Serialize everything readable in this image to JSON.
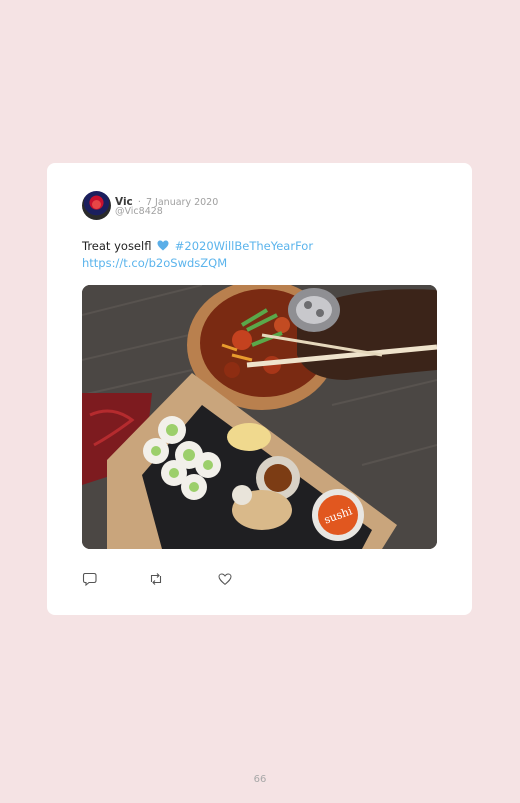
{
  "tweet": {
    "author_name": "Vic",
    "separator": "·",
    "date": "7 January 2020",
    "handle": "@Vic8428",
    "text_plain": "Treat yoselfl",
    "hashtag": "#2020WillBeTheYearFor",
    "link": "https://t.co/b2oSwdsZQM",
    "emoji": "blue-heart-icon",
    "image": "photo of sushi rolls in a kraft box with a poke bowl, hand with ornate silver ring holding chopsticks",
    "image_label_text": "sushi"
  },
  "actions": {
    "icons": [
      "reply-icon",
      "retweet-icon",
      "like-icon"
    ]
  },
  "page": {
    "number": "66"
  },
  "colors": {
    "background": "#f5e3e4",
    "card": "#ffffff",
    "link": "#5bb4ec",
    "muted": "#a0a0a0"
  }
}
